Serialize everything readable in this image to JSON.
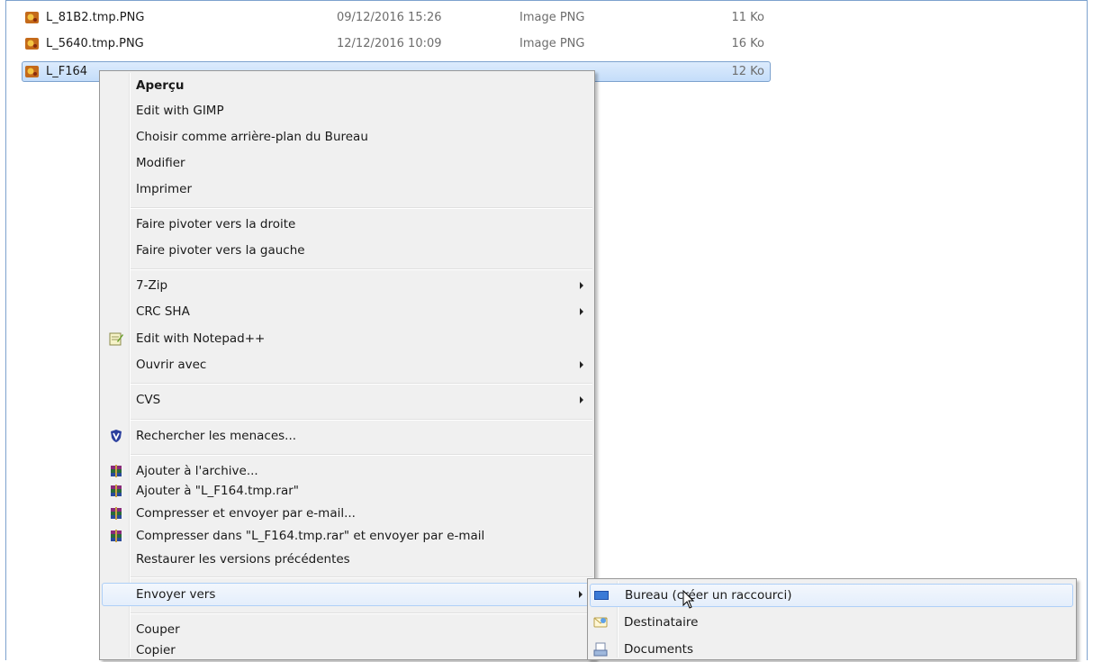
{
  "files": [
    {
      "name": "L_81B2.tmp.PNG",
      "date": "09/12/2016 15:26",
      "type": "Image PNG",
      "size": "11 Ko"
    },
    {
      "name": "L_5640.tmp.PNG",
      "date": "12/12/2016 10:09",
      "type": "Image PNG",
      "size": "16 Ko"
    },
    {
      "name": "L_F164",
      "date": "",
      "type": "",
      "size": "12 Ko"
    }
  ],
  "context_menu": {
    "items": [
      {
        "label": "Aperçu",
        "icon": ""
      },
      {
        "label": "Edit with GIMP",
        "icon": ""
      },
      {
        "label": "Choisir comme arrière-plan du Bureau",
        "icon": ""
      },
      {
        "label": "Modifier",
        "icon": ""
      },
      {
        "label": "Imprimer",
        "icon": ""
      },
      {
        "label": "Faire pivoter vers la droite",
        "icon": ""
      },
      {
        "label": "Faire pivoter vers la gauche",
        "icon": ""
      },
      {
        "label": "7-Zip",
        "icon": ""
      },
      {
        "label": "CRC SHA",
        "icon": ""
      },
      {
        "label": "Edit with Notepad++",
        "icon": "notepad-plus-plus-icon"
      },
      {
        "label": "Ouvrir avec",
        "icon": ""
      },
      {
        "label": "CVS",
        "icon": ""
      },
      {
        "label": "Rechercher les menaces...",
        "icon": "antivirus-shield-icon"
      },
      {
        "label": "Ajouter à l'archive...",
        "icon": "winrar-icon"
      },
      {
        "label": "Ajouter à \"L_F164.tmp.rar\"",
        "icon": "winrar-icon"
      },
      {
        "label": "Compresser et envoyer par e-mail...",
        "icon": "winrar-icon"
      },
      {
        "label": "Compresser dans \"L_F164.tmp.rar\" et envoyer par e-mail",
        "icon": "winrar-icon"
      },
      {
        "label": "Restaurer les versions précédentes",
        "icon": ""
      },
      {
        "label": "Envoyer vers",
        "icon": ""
      },
      {
        "label": "Couper",
        "icon": ""
      },
      {
        "label": "Copier",
        "icon": ""
      }
    ]
  },
  "send_to_menu": {
    "items": [
      {
        "label": "Bureau (créer un raccourci)",
        "icon": "desktop-icon"
      },
      {
        "label": "Destinataire",
        "icon": "mail-recipient-icon"
      },
      {
        "label": "Documents",
        "icon": "documents-icon"
      }
    ]
  },
  "colors": {
    "selection": "#cce4f7",
    "menu_bg": "#f0f0f0",
    "accent": "#7da2ce"
  }
}
